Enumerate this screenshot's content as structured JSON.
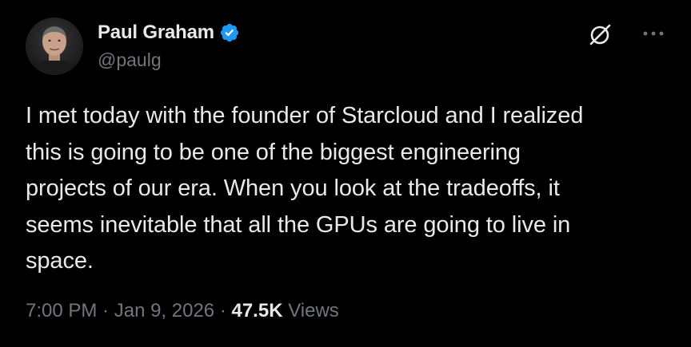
{
  "author": {
    "display_name": "Paul Graham",
    "handle": "@paulg",
    "verified": true,
    "verified_color": "#1d9bf0",
    "avatar_icon": "avatar-photo"
  },
  "actions": {
    "grok_icon": "grok-icon",
    "more_icon": "more-dots-icon"
  },
  "tweet": {
    "text": "I met today with the founder of Starcloud and I realized\nthis is going to be one of the biggest engineering\nprojects of our era. When you look at the tradeoffs, it\nseems inevitable that all the GPUs are going to live in\nspace."
  },
  "meta": {
    "time": "7:00 PM",
    "separator": " · ",
    "date": "Jan 9, 2026",
    "views_count": "47.5K",
    "views_label": " Views"
  },
  "colors": {
    "background": "#000000",
    "primary_text": "#e7e9ea",
    "secondary_text": "#71767b"
  }
}
